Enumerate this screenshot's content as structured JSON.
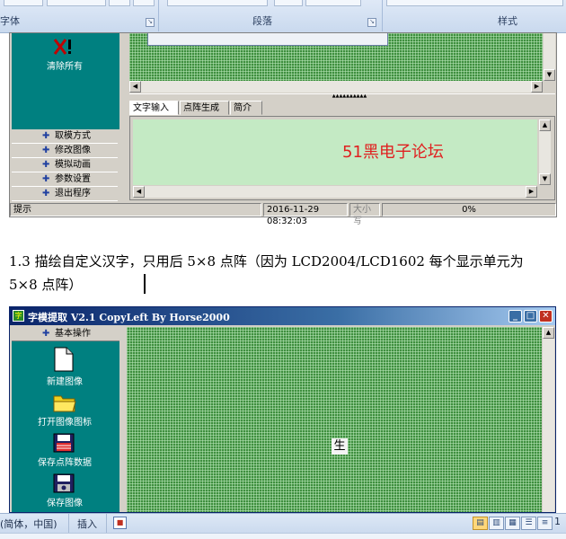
{
  "ribbon": {
    "groups": [
      {
        "label": "字体"
      },
      {
        "label": "段落"
      },
      {
        "label": "样式"
      }
    ]
  },
  "app1": {
    "tool_clear_all": "清除所有",
    "menu_items": [
      "取模方式",
      "修改图像",
      "模拟动画",
      "参数设置",
      "退出程序"
    ],
    "tabs": [
      "文字输入区",
      "点阵生成区",
      "简介"
    ],
    "input_text": "51黑电子论坛",
    "status": {
      "hint": "提示",
      "datetime": "2016-11-29 08:32:03",
      "caps": "大小写",
      "progress": "0%"
    }
  },
  "doc": {
    "paragraph": "1.3 描绘自定义汉字，只用后 5×8 点阵（因为 LCD2004/LCD1602 每个显示单元为 5×8 点阵）"
  },
  "app2": {
    "title": "字模提取 V2.1  CopyLeft By Horse2000",
    "section_header": "基本操作",
    "tools": [
      {
        "label": "新建图像"
      },
      {
        "label": "打开图像图标"
      },
      {
        "label": "保存点阵数据"
      },
      {
        "label": "保存图像"
      }
    ],
    "canvas_char": "生"
  },
  "word_status": {
    "language": "(简体，中国)",
    "insert_mode": "插入"
  }
}
